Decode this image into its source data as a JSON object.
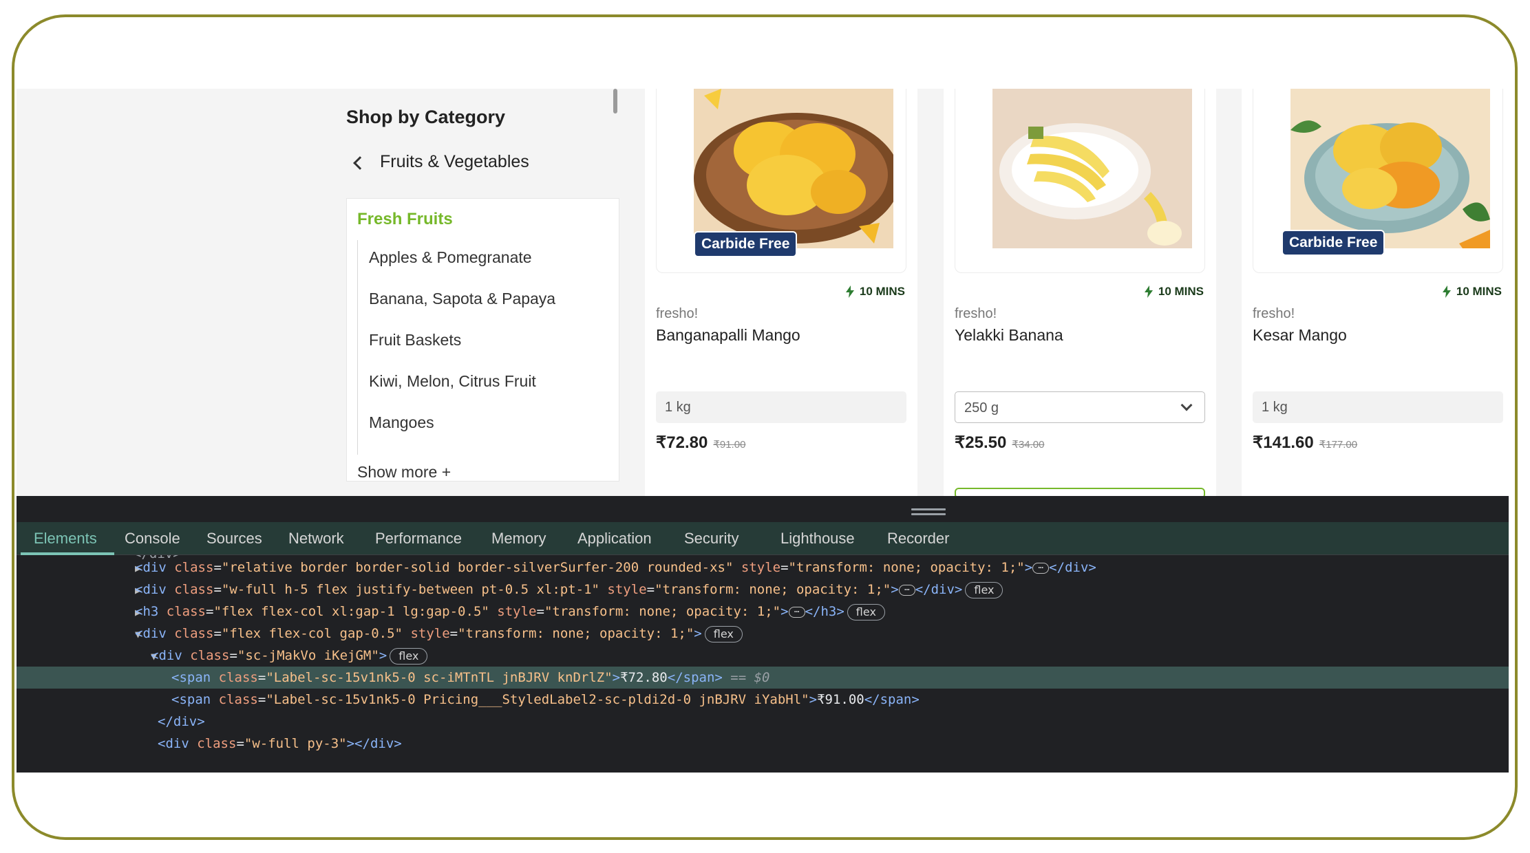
{
  "sidebar": {
    "title": "Shop by Category",
    "back_label": "Fruits & Vegetables",
    "active_category": "Fresh Fruits",
    "items": [
      "Apples & Pomegranate",
      "Banana, Sapota & Papaya",
      "Fruit Baskets",
      "Kiwi, Melon, Citrus Fruit",
      "Mangoes"
    ],
    "show_more": "Show more +"
  },
  "products": [
    {
      "badge": "Carbide Free",
      "eta": "10 MINS",
      "brand": "fresho!",
      "name": "Banganapalli Mango",
      "qty": "1 kg",
      "price": "₹72.80",
      "mrp": "₹91.00"
    },
    {
      "badge": "",
      "eta": "10 MINS",
      "brand": "fresho!",
      "name": "Yelakki Banana",
      "qty": "250 g",
      "price": "₹25.50",
      "mrp": "₹34.00"
    },
    {
      "badge": "Carbide Free",
      "eta": "10 MINS",
      "brand": "fresho!",
      "name": "Kesar Mango",
      "qty": "1 kg",
      "price": "₹141.60",
      "mrp": "₹177.00"
    }
  ],
  "devtools": {
    "tabs": [
      "Elements",
      "Console",
      "Sources",
      "Network",
      "Performance",
      "Memory",
      "Application",
      "Security",
      "Lighthouse",
      "Recorder"
    ],
    "active_tab": "Elements",
    "flex_badge": "flex",
    "lines": {
      "l1": {
        "tag": "div",
        "attr1": "class",
        "val1": "\"relative border border-solid border-silverSurfer-200 rounded-xs\"",
        "attr2": "style",
        "val2": "\"transform: none; opacity: 1;\""
      },
      "l2": {
        "tag": "div",
        "attr1": "class",
        "val1": "\"w-full h-5 flex justify-between pt-0.5 xl:pt-1\"",
        "attr2": "style",
        "val2": "\"transform: none; opacity: 1;\""
      },
      "l3": {
        "tag": "h3",
        "attr1": "class",
        "val1": "\"flex flex-col xl:gap-1 lg:gap-0.5\"",
        "attr2": "style",
        "val2": "\"transform: none; opacity: 1;\""
      },
      "l4": {
        "tag": "div",
        "attr1": "class",
        "val1": "\"flex flex-col gap-0.5\"",
        "attr2": "style",
        "val2": "\"transform: none; opacity: 1;\""
      },
      "l5": {
        "tag": "div",
        "attr1": "class",
        "val1": "\"sc-jMakVo iKejGM\""
      },
      "l6": {
        "tag": "span",
        "attr1": "class",
        "val1": "\"Label-sc-15v1nk5-0 sc-iMTnTL jnBJRV knDrlZ\"",
        "text": "₹72.80",
        "eq": " == $0"
      },
      "l7": {
        "tag": "span",
        "attr1": "class",
        "val1": "\"Label-sc-15v1nk5-0 Pricing___StyledLabel2-sc-pldi2d-0 jnBJRV iYabHl\"",
        "text": "₹91.00"
      },
      "l8": {
        "tag": "div"
      },
      "l9": {
        "tag": "div",
        "attr1": "class",
        "val1": "\"w-full py-3\""
      }
    }
  },
  "colors": {
    "accent_green": "#76b82a",
    "devtools_accent": "#7cc4b5",
    "frame": "#8c8a2b",
    "badge_bg": "#1f3a6d"
  }
}
